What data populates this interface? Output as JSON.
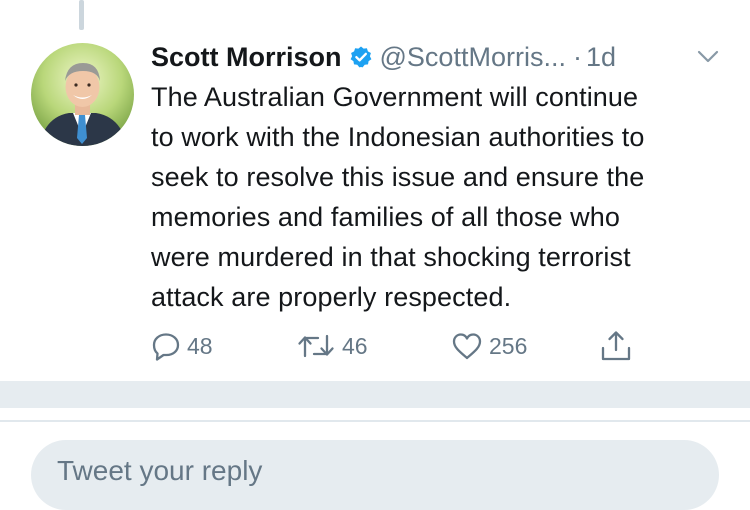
{
  "tweet": {
    "author_name": "Scott Morrison",
    "handle": "@ScottMorris...",
    "separator": "·",
    "time": "1d",
    "text": "The Australian Government will continue\nto work with the Indonesian authorities to\nseek to resolve this issue and ensure the\nmemories and families of all those who\nwere murdered in that shocking terrorist\nattack are properly respected."
  },
  "actions": {
    "reply_count": "48",
    "retweet_count": "46",
    "like_count": "256"
  },
  "reply_box": {
    "placeholder": "Tweet your reply"
  },
  "colors": {
    "accent": "#1da1f2",
    "secondary_text": "#657786",
    "divider": "#e6ecf0"
  },
  "icons": [
    "verified-badge-icon",
    "chevron-down-icon",
    "reply-icon",
    "retweet-icon",
    "like-icon",
    "share-icon"
  ]
}
